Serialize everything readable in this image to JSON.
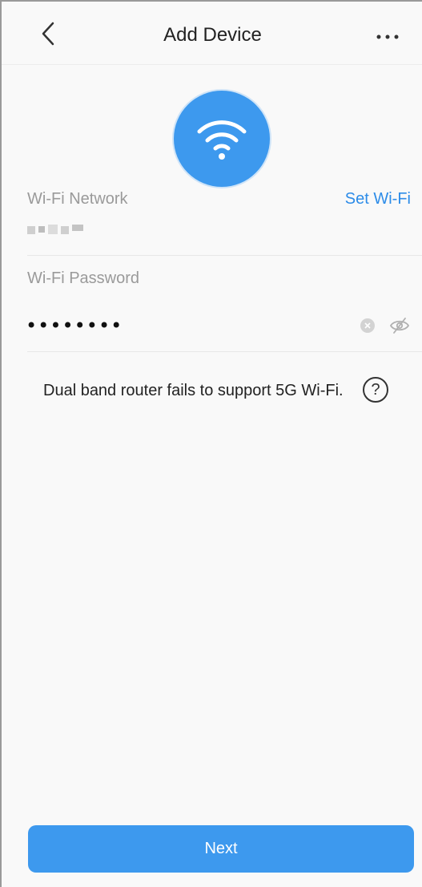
{
  "header": {
    "title": "Add Device",
    "back_icon": "chevron-left-icon",
    "more_icon": "more-horizontal-icon"
  },
  "wifi_icon": {
    "icon": "wifi-icon",
    "color": "#3d99ee"
  },
  "network": {
    "label": "Wi-Fi Network",
    "action_label": "Set Wi-Fi"
  },
  "password": {
    "label": "Wi-Fi Password",
    "value": "••••••••",
    "clear_icon": "clear-icon",
    "visibility_icon": "eye-off-icon"
  },
  "hint": {
    "text": "Dual band router fails to support 5G Wi-Fi.",
    "help_symbol": "?"
  },
  "footer": {
    "next_label": "Next"
  },
  "colors": {
    "accent": "#3d99ee",
    "link": "#2d8ce8"
  }
}
